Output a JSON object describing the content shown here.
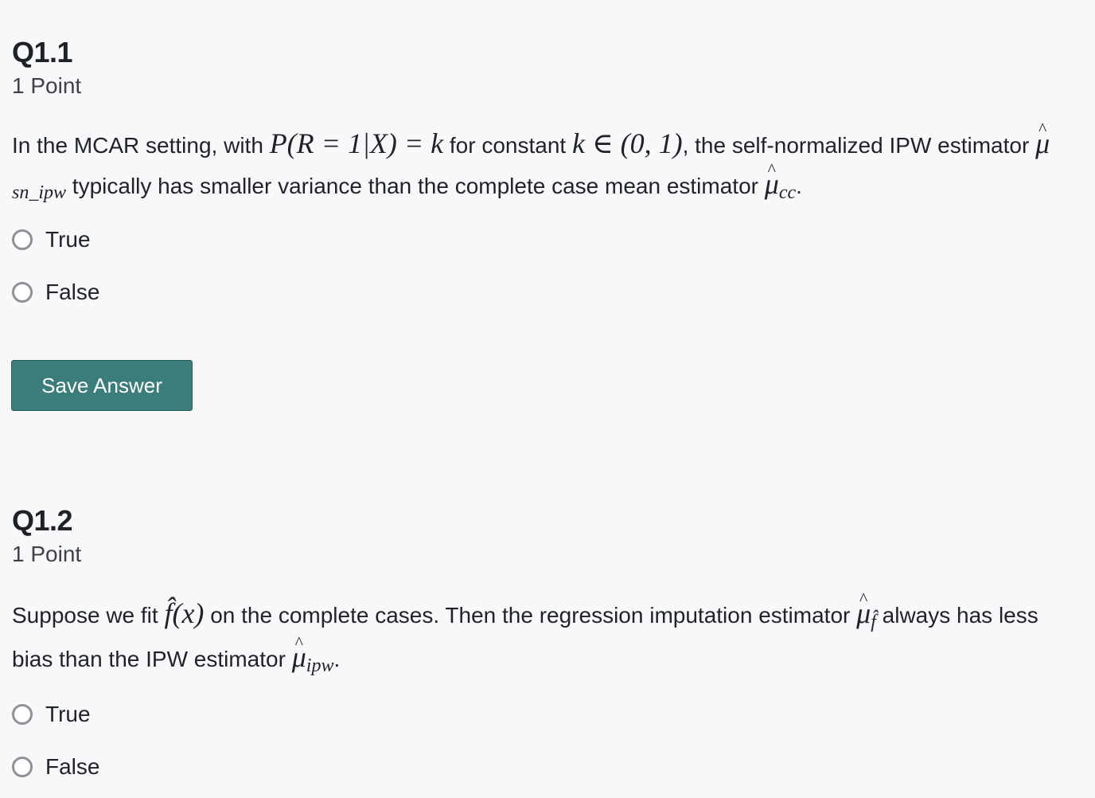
{
  "questions": [
    {
      "title": "Q1.1",
      "points": "1 Point",
      "text": {
        "t1": "In the MCAR setting, with ",
        "m1": "P(R = 1|X) = k",
        "t2": " for constant ",
        "m2": "k ∈ (0, 1)",
        "t3": ", the self-normalized IPW estimator ",
        "m3_base": "μ",
        "m3_sub": "sn_ipw",
        "t4": " typically has smaller variance than the complete case mean estimator ",
        "m4_base": "μ",
        "m4_sub": "cc",
        "t5": "."
      },
      "options": [
        "True",
        "False"
      ]
    },
    {
      "title": "Q1.2",
      "points": "1 Point",
      "text": {
        "t1": "Suppose we fit ",
        "m1": "f̂(x)",
        "t2": " on the complete cases. Then the regression imputation estimator ",
        "m2_base": "μ",
        "m2_sub": "f̂",
        "t3": " always has less bias than the IPW estimator ",
        "m3_base": "μ",
        "m3_sub": "ipw",
        "t4": "."
      },
      "options": [
        "True",
        "False"
      ]
    }
  ],
  "save_button_label": "Save Answer",
  "colors": {
    "background": "#f8f8fa",
    "save_button": "#3a7d7b",
    "radio_border": "#8e9297"
  }
}
